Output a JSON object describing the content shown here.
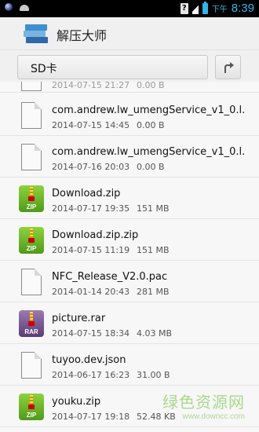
{
  "status_bar": {
    "ampm": "下午",
    "time": "8:39",
    "question_icon_text": "?",
    "accent_color": "#33b5e5"
  },
  "title_bar": {
    "app_icon": "books-stack-icon",
    "title": "解压大师"
  },
  "path_bar": {
    "current_path": "SD卡",
    "up_icon": "folder-up-arrow-icon"
  },
  "files": [
    {
      "icon": "doc",
      "name": "",
      "date": "2014-07-15 21:27",
      "size": "0.00 B"
    },
    {
      "icon": "doc",
      "name": "com.andrew.lw_umengService_v1_0.l.",
      "date": "2014-07-15 14:45",
      "size": "0.00 B"
    },
    {
      "icon": "doc",
      "name": "com.andrew.lw_umengService_v1_0.l.",
      "date": "2014-07-16 20:03",
      "size": "0.00 B"
    },
    {
      "icon": "zip",
      "icon_label": "ZIP",
      "name": "Download.zip",
      "date": "2014-07-17 19:35",
      "size": "151 MB"
    },
    {
      "icon": "zip",
      "icon_label": "ZIP",
      "name": "Download.zip.zip",
      "date": "2014-07-15 11:19",
      "size": "151 MB"
    },
    {
      "icon": "doc",
      "name": "NFC_Release_V2.0.pac",
      "date": "2014-01-14 20:43",
      "size": "281 MB"
    },
    {
      "icon": "rar",
      "icon_label": "RAR",
      "name": "picture.rar",
      "date": "2014-07-15 18:34",
      "size": "4.03 MB"
    },
    {
      "icon": "doc",
      "name": "tuyoo.dev.json",
      "date": "2014-06-17 16:23",
      "size": "31.00 B"
    },
    {
      "icon": "zip",
      "icon_label": "ZIP",
      "name": "youku.zip",
      "date": "2014-07-17 19:18",
      "size": "52.48 KB"
    }
  ],
  "watermark": {
    "main": "绿色资源网",
    "sub": "www.downcc.com"
  }
}
